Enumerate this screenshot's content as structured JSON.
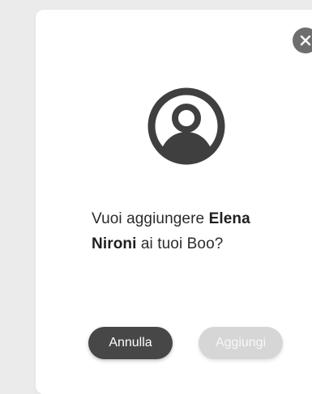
{
  "dialog": {
    "message_prefix": "Vuoi aggiungere ",
    "user_name_first": "Elena",
    "user_name_last": "Nironi",
    "message_suffix": " ai tuoi Boo?",
    "icon": "user-circle-icon",
    "close_icon": "close-icon"
  },
  "buttons": {
    "cancel_label": "Annulla",
    "add_label": "Aggiungi"
  },
  "colors": {
    "background": "#ebebeb",
    "modal": "#ffffff",
    "icon": "#3f3f3f",
    "close_bg": "#6e6e6e",
    "cancel_bg": "#474747",
    "add_bg_disabled": "#d6d6d6",
    "text": "#2b2b2b"
  }
}
